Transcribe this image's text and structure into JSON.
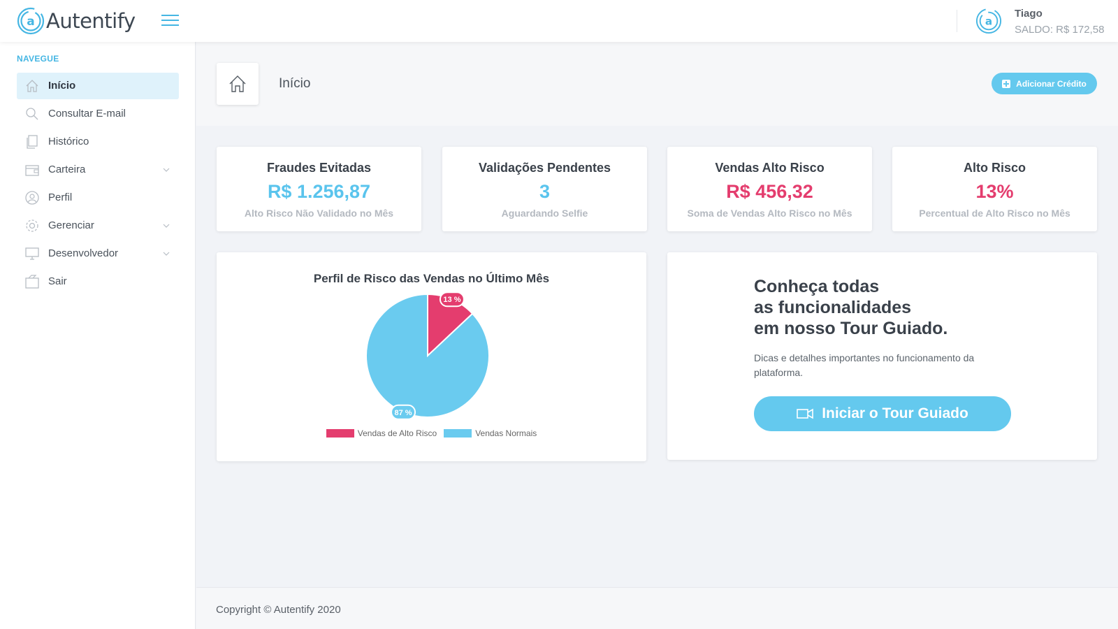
{
  "app": {
    "name": "Autentify",
    "accent_color": "#5ac4ed",
    "danger_color": "#e43d6e"
  },
  "header": {
    "user_name": "Tiago",
    "balance": "SALDO: R$ 172,58",
    "menu_icon": "hamburger-icon"
  },
  "sidebar": {
    "section_title": "NAVEGUE",
    "items": [
      {
        "label": "Início",
        "icon": "home-icon",
        "active": true,
        "has_submenu": false
      },
      {
        "label": "Consultar E-mail",
        "icon": "search-icon",
        "active": false,
        "has_submenu": false
      },
      {
        "label": "Histórico",
        "icon": "documents-icon",
        "active": false,
        "has_submenu": false
      },
      {
        "label": "Carteira",
        "icon": "wallet-icon",
        "active": false,
        "has_submenu": true
      },
      {
        "label": "Perfil",
        "icon": "user-icon",
        "active": false,
        "has_submenu": false
      },
      {
        "label": "Gerenciar",
        "icon": "gear-icon",
        "active": false,
        "has_submenu": true
      },
      {
        "label": "Desenvolvedor",
        "icon": "monitor-icon",
        "active": false,
        "has_submenu": true
      },
      {
        "label": "Sair",
        "icon": "exit-icon",
        "active": false,
        "has_submenu": false
      }
    ]
  },
  "page": {
    "title": "Início",
    "add_credit_label": "Adicionar Crédito"
  },
  "stats": [
    {
      "title": "Fraudes Evitadas",
      "value": "R$ 1.256,87",
      "subtitle": "Alto Risco Não Validado no Mês",
      "color": "blue"
    },
    {
      "title": "Validações Pendentes",
      "value": "3",
      "subtitle": "Aguardando Selfie",
      "color": "blue"
    },
    {
      "title": "Vendas Alto Risco",
      "value": "R$ 456,32",
      "subtitle": "Soma de Vendas Alto Risco no Mês",
      "color": "pink"
    },
    {
      "title": "Alto Risco",
      "value": "13%",
      "subtitle": "Percentual de Alto Risco no Mês",
      "color": "pink"
    }
  ],
  "chart_data": {
    "type": "pie",
    "title": "Perfil de Risco das Vendas no Último Mês",
    "categories": [
      "Vendas de Alto Risco",
      "Vendas Normais"
    ],
    "values": [
      13,
      87
    ],
    "labels": [
      "13 %",
      "87 %"
    ],
    "colors": [
      "#e43d6e",
      "#6acbef"
    ],
    "legend": "bottom"
  },
  "tour": {
    "heading_lines": [
      "Conheça todas",
      "as funcionalidades",
      "em nosso Tour Guiado."
    ],
    "text": "Dicas e detalhes importantes no funcionamento da plataforma.",
    "button_label": "Iniciar o Tour Guiado",
    "button_icon": "video-camera-icon"
  },
  "footer": {
    "copyright": "Copyright © Autentify 2020"
  }
}
